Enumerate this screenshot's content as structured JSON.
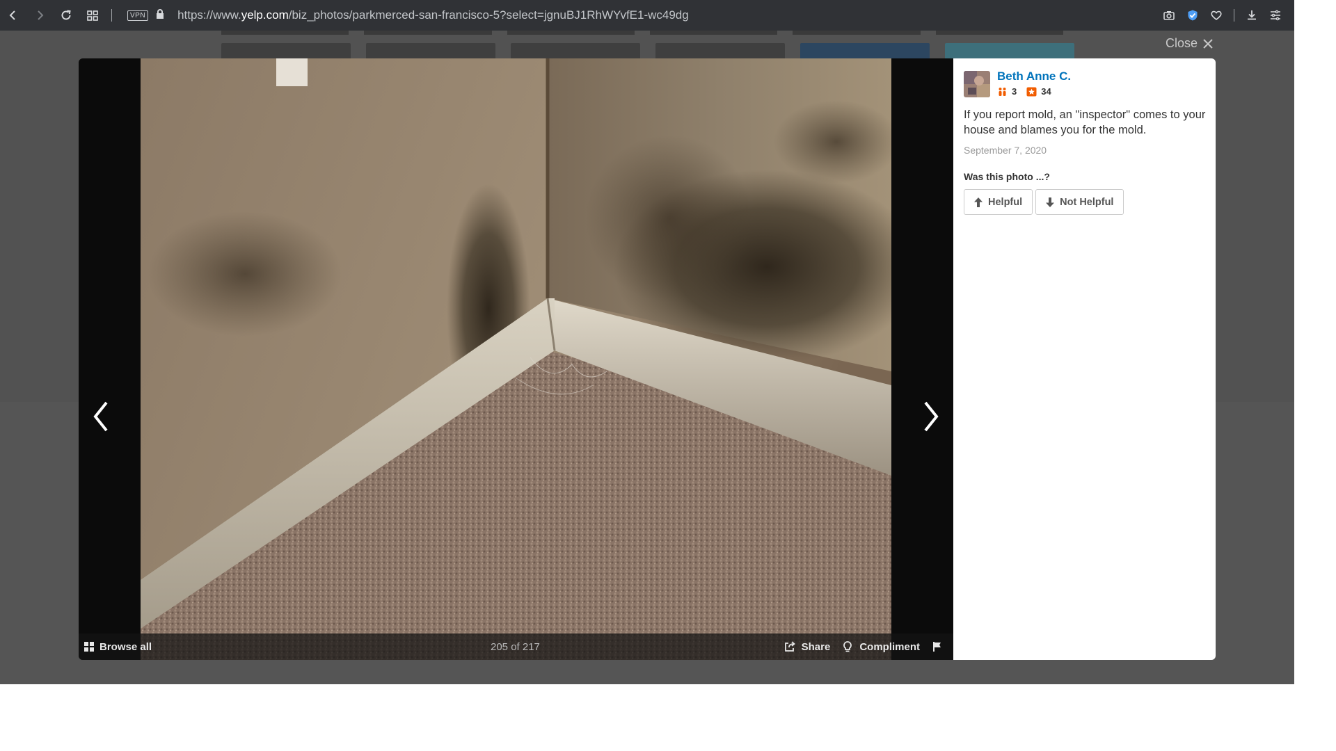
{
  "browser": {
    "vpn_label": "VPN",
    "url_prefix": "https://www.",
    "url_host": "yelp.com",
    "url_path": "/biz_photos/parkmerced-san-francisco-5?select=jgnuBJ1RhWYvfE1-wc49dg"
  },
  "lightbox": {
    "close_label": "Close",
    "browse_label": "Browse all",
    "counter": "205 of 217",
    "share_label": "Share",
    "compliment_label": "Compliment"
  },
  "photo_info": {
    "user_name": "Beth Anne C.",
    "friends_count": "3",
    "reviews_count": "34",
    "caption": "If you report mold, an \"inspector\" comes to your house and blames you for the mold.",
    "date": "September 7, 2020",
    "question": "Was this photo ...?",
    "helpful_label": "Helpful",
    "not_helpful_label": "Not Helpful"
  },
  "colors": {
    "link_blue": "#0073bb",
    "toolbar_bg": "#303236",
    "overlay_bg": "#525252",
    "friends_icon": "#f15c00",
    "reviews_icon": "#f15c00"
  }
}
